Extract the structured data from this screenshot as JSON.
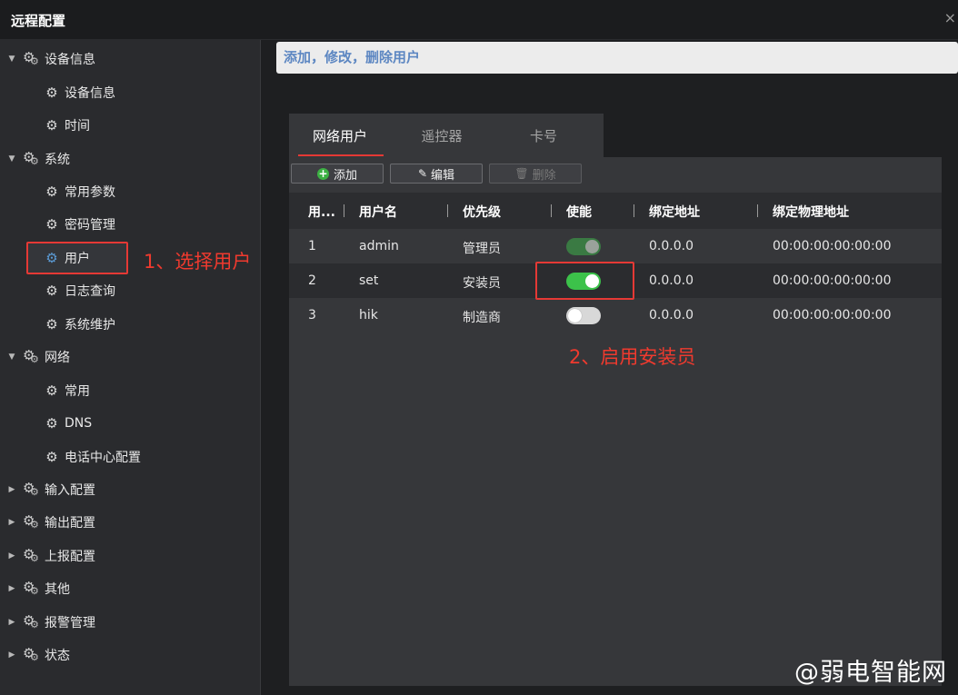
{
  "window": {
    "title": "远程配置",
    "close_glyph": "×"
  },
  "sidebar": {
    "items": [
      {
        "label": "设备信息",
        "level": 1,
        "expanded": true
      },
      {
        "label": "设备信息",
        "level": 2
      },
      {
        "label": "时间",
        "level": 2
      },
      {
        "label": "系统",
        "level": 1,
        "expanded": true
      },
      {
        "label": "常用参数",
        "level": 2
      },
      {
        "label": "密码管理",
        "level": 2
      },
      {
        "label": "用户",
        "level": 2,
        "selected": true
      },
      {
        "label": "日志查询",
        "level": 2
      },
      {
        "label": "系统维护",
        "level": 2
      },
      {
        "label": "网络",
        "level": 1,
        "expanded": true
      },
      {
        "label": "常用",
        "level": 2
      },
      {
        "label": "DNS",
        "level": 2
      },
      {
        "label": "电话中心配置",
        "level": 2
      },
      {
        "label": "输入配置",
        "level": 1,
        "expanded": false
      },
      {
        "label": "输出配置",
        "level": 1,
        "expanded": false
      },
      {
        "label": "上报配置",
        "level": 1,
        "expanded": false
      },
      {
        "label": "其他",
        "level": 1,
        "expanded": false
      },
      {
        "label": "报警管理",
        "level": 1,
        "expanded": false
      },
      {
        "label": "状态",
        "level": 1,
        "expanded": false
      }
    ]
  },
  "banner": {
    "text": "添加，修改，删除用户"
  },
  "tabs": [
    {
      "label": "网络用户",
      "active": true
    },
    {
      "label": "遥控器",
      "active": false
    },
    {
      "label": "卡号",
      "active": false
    }
  ],
  "toolbar": {
    "add_label": "添加",
    "edit_label": "编辑",
    "delete_label": "删除"
  },
  "table": {
    "columns": [
      "用...",
      "用户名",
      "优先级",
      "使能",
      "绑定地址",
      "绑定物理地址"
    ],
    "rows": [
      {
        "id": "1",
        "name": "admin",
        "priority": "管理员",
        "enabled": "on-dim",
        "address": "0.0.0.0",
        "mac": "00:00:00:00:00:00"
      },
      {
        "id": "2",
        "name": "set",
        "priority": "安装员",
        "enabled": "on",
        "address": "0.0.0.0",
        "mac": "00:00:00:00:00:00"
      },
      {
        "id": "3",
        "name": "hik",
        "priority": "制造商",
        "enabled": "off",
        "address": "0.0.0.0",
        "mac": "00:00:00:00:00:00"
      }
    ]
  },
  "annotations": {
    "step1": "1、选择用户",
    "step2": "2、启用安装员"
  },
  "watermark": "@弱电智能网",
  "colors": {
    "accent_red": "#e53935",
    "switch_on": "#3cc24a",
    "banner_text": "#5d87c2"
  }
}
